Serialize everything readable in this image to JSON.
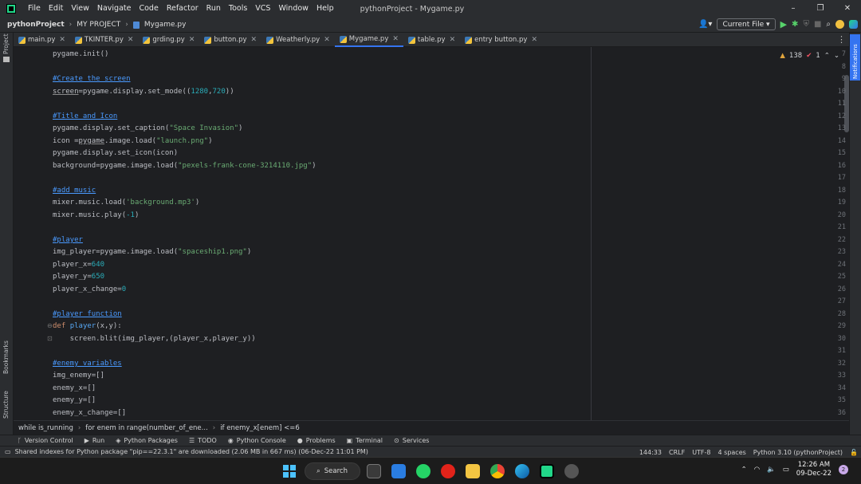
{
  "title_bar": {
    "menu": [
      "File",
      "Edit",
      "View",
      "Navigate",
      "Code",
      "Refactor",
      "Run",
      "Tools",
      "VCS",
      "Window",
      "Help"
    ],
    "window_title": "pythonProject - Mygame.py",
    "controls": [
      "–",
      "❐",
      "✕"
    ]
  },
  "nav": {
    "project": "pythonProject",
    "folder": "MY PROJECT",
    "file": "Mygame.py",
    "run_config": "Current File"
  },
  "left_strip": {
    "project": "Project",
    "bookmarks": "Bookmarks",
    "structure": "Structure"
  },
  "right_strip": {
    "notifications": "Notifications"
  },
  "tabs": [
    {
      "label": "main.py"
    },
    {
      "label": "TKINTER.py"
    },
    {
      "label": "grding.py"
    },
    {
      "label": "button.py"
    },
    {
      "label": "Weatherly.py"
    },
    {
      "label": "Mygame.py"
    },
    {
      "label": "table.py"
    },
    {
      "label": "entry button.py"
    }
  ],
  "inspections": {
    "warnings": "138",
    "errors": "1"
  },
  "editor": {
    "line_numbers": [
      "7",
      "8",
      "9",
      "10",
      "11",
      "12",
      "13",
      "14",
      "15",
      "16",
      "17",
      "18",
      "19",
      "20",
      "21",
      "22",
      "23",
      "24",
      "25",
      "26",
      "27",
      "28",
      "29",
      "30",
      "31",
      "32",
      "33",
      "34",
      "35",
      "36"
    ]
  },
  "code_crumbs": [
    "while is_running",
    "for enem in range(number_of_ene...",
    "if enemy_x[enem] <=6"
  ],
  "tool_windows": [
    "Version Control",
    "Run",
    "Python Packages",
    "TODO",
    "Python Console",
    "Problems",
    "Terminal",
    "Services"
  ],
  "status": {
    "message": "Shared indexes for Python package \"pip==22.3.1\" are downloaded (2.06 MB in 667 ms) (06-Dec-22 11:01 PM)",
    "position": "144:33",
    "line_sep": "CRLF",
    "encoding": "UTF-8",
    "indent": "4 spaces",
    "interpreter": "Python 3.10 (pythonProject)"
  },
  "taskbar": {
    "search": "Search",
    "time": "12:26 AM",
    "date": "09-Dec-22",
    "badge": "2"
  },
  "colors": {
    "accent": "#3574f0",
    "comment": "#4a9aff",
    "string": "#6aab73",
    "number": "#2aacb8",
    "keyword": "#cf8e6d"
  }
}
